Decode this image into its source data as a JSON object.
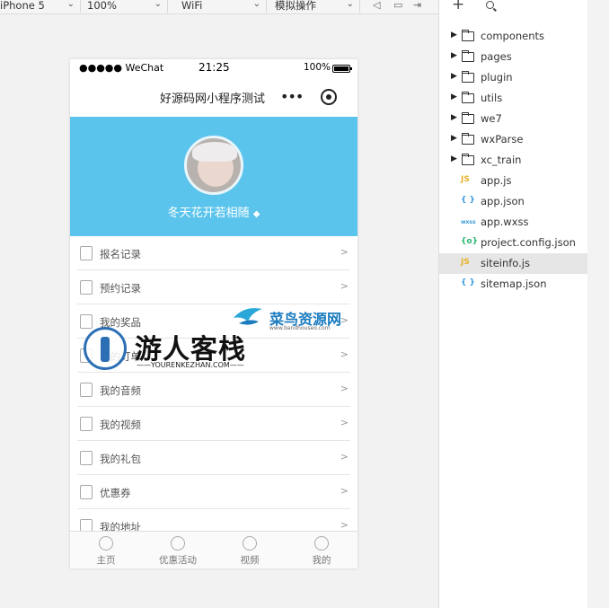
{
  "toolbar": {
    "device": "iPhone 5",
    "zoom": "100%",
    "network": "WiFi",
    "operation": "模拟操作"
  },
  "phone": {
    "status": {
      "carrier": "●●●●● WeChat",
      "time": "21:25",
      "battery": "100%"
    },
    "nav_title": "好源码网小程序测试",
    "nav_more": "•••",
    "nickname": "冬天花开若相随",
    "menu": [
      {
        "label": "报名记录",
        "icon": "document-icon"
      },
      {
        "label": "预约记录",
        "icon": "checkbox-icon"
      },
      {
        "label": "我的奖品",
        "icon": "gift-icon"
      },
      {
        "label": "我的订单",
        "icon": "order-icon"
      },
      {
        "label": "我的音频",
        "icon": "music-icon"
      },
      {
        "label": "我的视频",
        "icon": "video-icon"
      },
      {
        "label": "我的礼包",
        "icon": "package-icon"
      },
      {
        "label": "优惠券",
        "icon": "coupon-icon"
      },
      {
        "label": "我的地址",
        "icon": "location-icon"
      }
    ],
    "menu_arrow": ">",
    "tabs": [
      {
        "label": "主页",
        "icon": "home-icon"
      },
      {
        "label": "优惠活动",
        "icon": "user-icon"
      },
      {
        "label": "视频",
        "icon": "video-circle-icon"
      },
      {
        "label": "我的",
        "icon": "profile-icon"
      }
    ]
  },
  "watermark": {
    "brand1": "菜鸟资源网",
    "brand1_url": "www.bandhouseo.com",
    "brand2": "游人客栈",
    "brand2_url": "——YOURENKEZHAN.COM——"
  },
  "file_tree": [
    {
      "name": "components",
      "type": "folder"
    },
    {
      "name": "pages",
      "type": "folder"
    },
    {
      "name": "plugin",
      "type": "folder"
    },
    {
      "name": "utils",
      "type": "folder"
    },
    {
      "name": "we7",
      "type": "folder"
    },
    {
      "name": "wxParse",
      "type": "folder"
    },
    {
      "name": "xc_train",
      "type": "folder"
    },
    {
      "name": "app.js",
      "type": "js",
      "badge": "JS",
      "color": "#e8b32a"
    },
    {
      "name": "app.json",
      "type": "json",
      "badge": "{ }",
      "color": "#3a9bd9"
    },
    {
      "name": "app.wxss",
      "type": "wxss",
      "badge": "wxss",
      "color": "#3a9bd9"
    },
    {
      "name": "project.config.json",
      "type": "config",
      "badge": "{o}",
      "color": "#2bb673"
    },
    {
      "name": "siteinfo.js",
      "type": "js",
      "badge": "JS",
      "color": "#e8b32a",
      "selected": true
    },
    {
      "name": "sitemap.json",
      "type": "json",
      "badge": "{ }",
      "color": "#3a9bd9"
    }
  ],
  "colors": {
    "profile_bg": "#5bc4ec",
    "selected_row": "#e6e6e6"
  }
}
